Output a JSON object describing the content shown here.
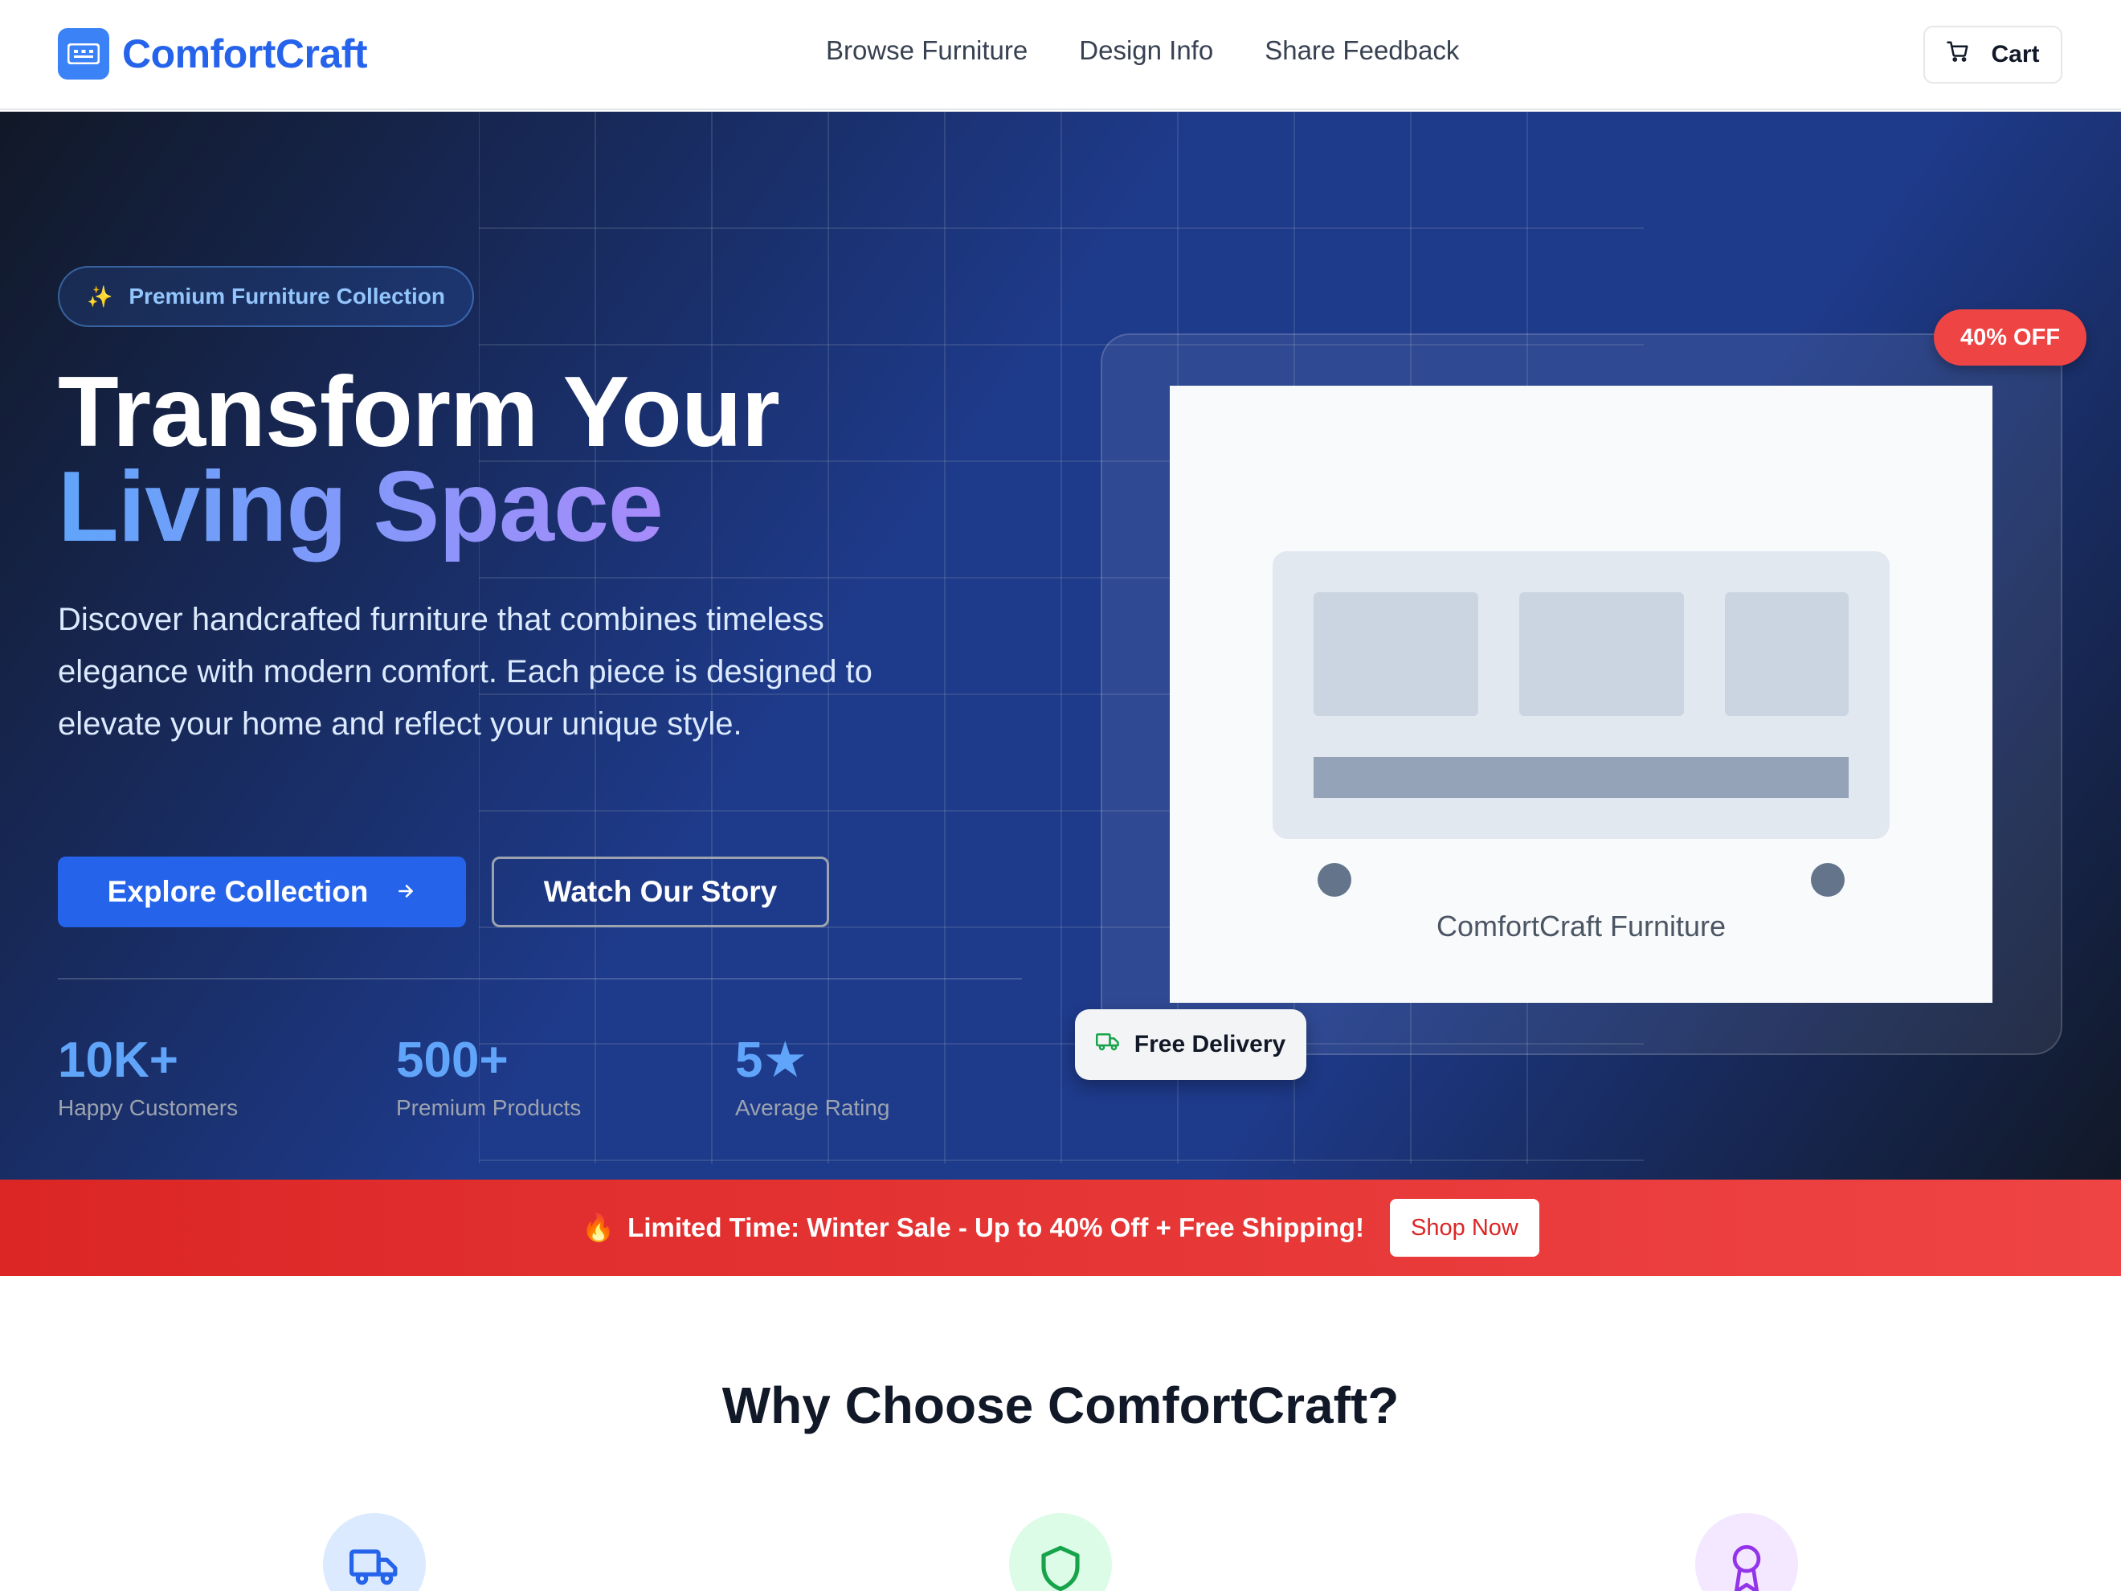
{
  "header": {
    "brand": "ComfortCraft",
    "nav": [
      "Browse Furniture",
      "Design Info",
      "Share Feedback"
    ],
    "cart_label": "Cart"
  },
  "hero": {
    "badge": "Premium Furniture Collection",
    "title_line1": "Transform Your",
    "title_line2": "Living Space",
    "description": "Discover handcrafted furniture that combines timeless elegance with modern comfort. Each piece is designed to elevate your home and reflect your unique style.",
    "primary_cta": "Explore Collection",
    "secondary_cta": "Watch Our Story",
    "stats": [
      {
        "value": "10K+",
        "label": "Happy Customers"
      },
      {
        "value": "500+",
        "label": "Premium Products"
      },
      {
        "value": "5★",
        "label": "Average Rating"
      }
    ],
    "product": {
      "caption": "ComfortCraft Furniture",
      "discount": "40% OFF",
      "delivery": "Free Delivery"
    }
  },
  "promo": {
    "emoji": "🔥",
    "text": "Limited Time: Winter Sale - Up to 40% Off + Free Shipping!",
    "button": "Shop Now"
  },
  "why": {
    "title": "Why Choose ComfortCraft?",
    "features": [
      {
        "icon": "truck-icon"
      },
      {
        "icon": "shield-icon"
      },
      {
        "icon": "award-icon"
      }
    ]
  },
  "colors": {
    "brand": "#2563eb",
    "hero_start": "#111827",
    "hero_mid": "#1e3a8a",
    "sale": "#ef4444",
    "feature_blue_bg": "#dbeafe",
    "feature_green_bg": "#dcfce7",
    "feature_purple_bg": "#f3e8ff"
  }
}
